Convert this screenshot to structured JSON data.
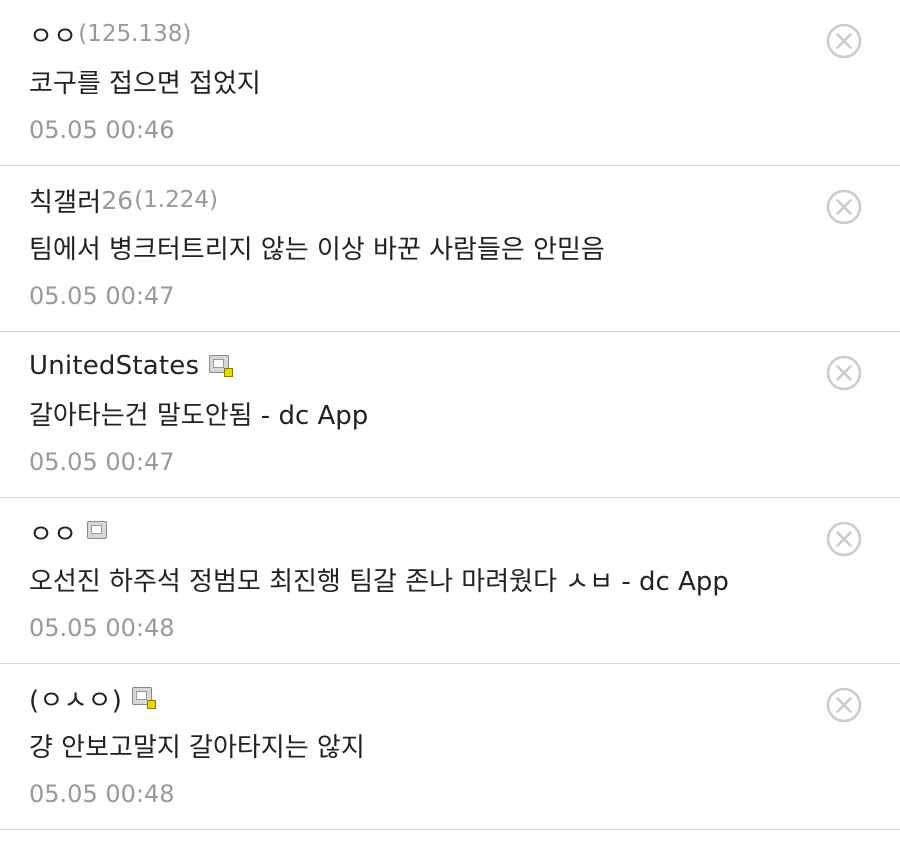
{
  "comments": [
    {
      "nickname": "ㅇㅇ",
      "level": "",
      "ip": "(125.138)",
      "badge": false,
      "badge_dot": false,
      "text": "코구를 접으면 접었지",
      "time": "05.05 00:46"
    },
    {
      "nickname": "칙갤러",
      "level": "26",
      "ip": "(1.224)",
      "badge": false,
      "badge_dot": false,
      "text": "팀에서 병크터트리지 않는 이상 바꾼 사람들은 안믿음",
      "time": "05.05 00:47"
    },
    {
      "nickname": "UnitedStates",
      "level": "",
      "ip": "",
      "badge": true,
      "badge_dot": true,
      "text": "갈아타는건 말도안됨 - dc App",
      "time": "05.05 00:47"
    },
    {
      "nickname": "ㅇㅇ",
      "level": "",
      "ip": "",
      "badge": true,
      "badge_dot": false,
      "text": "오선진 하주석 정범모 최진행 팀갈 존나 마려웠다 ㅅㅂ - dc App",
      "time": "05.05 00:48"
    },
    {
      "nickname": "(ㅇㅅㅇ)",
      "level": "",
      "ip": "",
      "badge": true,
      "badge_dot": true,
      "text": "걍 안보고말지 갈아타지는 않지",
      "time": "05.05 00:48"
    }
  ],
  "icons": {
    "delete": "close-circle-icon",
    "badge": "gallery-member-icon"
  },
  "colors": {
    "text": "#222222",
    "muted": "#999999",
    "divider": "#d7d7d7",
    "icon": "#cccccc",
    "badge_dot": "#f2d300"
  }
}
